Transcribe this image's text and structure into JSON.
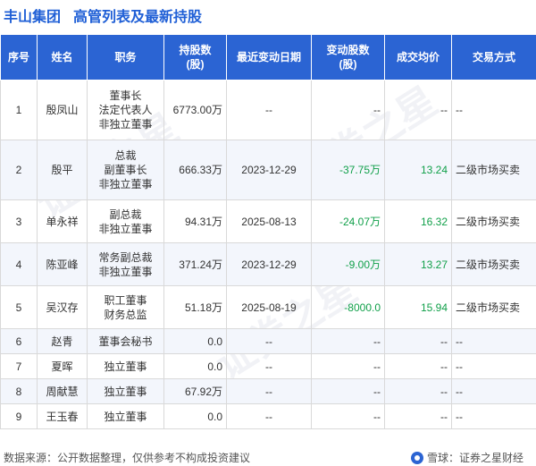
{
  "header": {
    "company": "丰山集团",
    "title": "高管列表及最新持股"
  },
  "table": {
    "columns": [
      "序号",
      "姓名",
      "职务",
      "持股数\n(股)",
      "最近变动日期",
      "变动股数\n(股)",
      "成交均价",
      "交易方式"
    ],
    "rows": [
      {
        "idx": "1",
        "name": "殷凤山",
        "positions": [
          "董事长",
          "法定代表人",
          "非独立董事"
        ],
        "holding": "6773.00万",
        "date": "--",
        "change": "--",
        "price": "--",
        "mode": "--"
      },
      {
        "idx": "2",
        "name": "殷平",
        "positions": [
          "总裁",
          "副董事长",
          "非独立董事"
        ],
        "holding": "666.33万",
        "date": "2023-12-29",
        "change": "-37.75万",
        "price": "13.24",
        "mode": "二级市场买卖"
      },
      {
        "idx": "3",
        "name": "单永祥",
        "positions": [
          "副总裁",
          "非独立董事"
        ],
        "holding": "94.31万",
        "date": "2025-08-13",
        "change": "-24.07万",
        "price": "16.32",
        "mode": "二级市场买卖"
      },
      {
        "idx": "4",
        "name": "陈亚峰",
        "positions": [
          "常务副总裁",
          "非独立董事"
        ],
        "holding": "371.24万",
        "date": "2023-12-29",
        "change": "-9.00万",
        "price": "13.27",
        "mode": "二级市场买卖"
      },
      {
        "idx": "5",
        "name": "吴汉存",
        "positions": [
          "职工董事",
          "财务总监"
        ],
        "holding": "51.18万",
        "date": "2025-08-19",
        "change": "-8000.0",
        "price": "15.94",
        "mode": "二级市场买卖"
      },
      {
        "idx": "6",
        "name": "赵青",
        "positions": [
          "董事会秘书"
        ],
        "holding": "0.0",
        "date": "--",
        "change": "--",
        "price": "--",
        "mode": "--"
      },
      {
        "idx": "7",
        "name": "夏晖",
        "positions": [
          "独立董事"
        ],
        "holding": "0.0",
        "date": "--",
        "change": "--",
        "price": "--",
        "mode": "--"
      },
      {
        "idx": "8",
        "name": "周献慧",
        "positions": [
          "独立董事"
        ],
        "holding": "67.92万",
        "date": "--",
        "change": "--",
        "price": "--",
        "mode": "--"
      },
      {
        "idx": "9",
        "name": "王玉春",
        "positions": [
          "独立董事"
        ],
        "holding": "0.0",
        "date": "--",
        "change": "--",
        "price": "--",
        "mode": "--"
      }
    ]
  },
  "watermark": {
    "text": "证券之星"
  },
  "footer": {
    "source": "数据来源：公开数据整理，仅供参考不构成投资建议",
    "brand": "雪球：证券之星财经"
  },
  "colors": {
    "header_bg": "#2b64d3",
    "title": "#1f5fd6",
    "negative_change": "#11a04a",
    "stripe": "#f3f6fc"
  }
}
